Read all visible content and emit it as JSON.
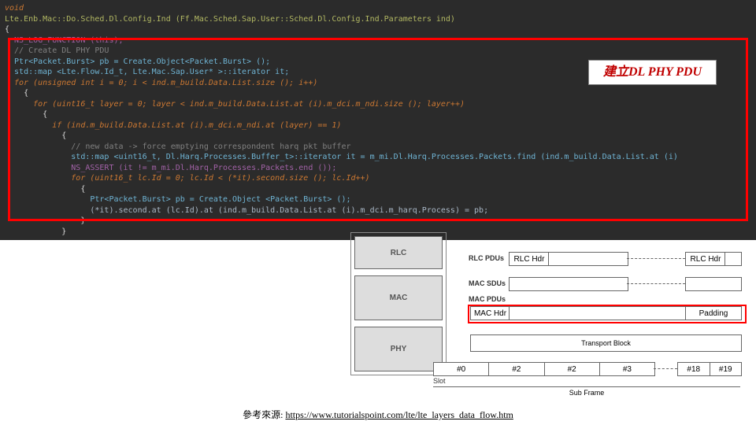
{
  "code": {
    "l1a": "void",
    "l1b": "Lte.Enb.Mac::Do.Sched.Dl.Config.Ind (Ff.Mac.Sched.Sap.User::Sched.Dl.Config.Ind.Parameters ind)",
    "l2": "{",
    "l3": "  NS_LOG_FUNCTION (this);",
    "l4": "  // Create DL PHY PDU",
    "l5": "  Ptr<Packet.Burst> pb = Create.Object<Packet.Burst> ();",
    "l6": "  std::map <Lte.Flow.Id_t, Lte.Mac.Sap.User* >::iterator it;",
    "l7": "",
    "l8": "  for (unsigned int i = 0; i < ind.m_build.Data.List.size (); i++)",
    "l9": "    {",
    "l10": "      for (uint16_t layer = 0; layer < ind.m_build.Data.List.at (i).m_dci.m_ndi.size (); layer++)",
    "l11": "        {",
    "l12": "          if (ind.m_build.Data.List.at (i).m_dci.m_ndi.at (layer) == 1)",
    "l13": "            {",
    "l14": "              // new data -> force emptying correspondent harq pkt buffer",
    "l15": "              std::map <uint16_t, Dl.Harq.Processes.Buffer_t>::iterator it = m_mi.Dl.Harq.Processes.Packets.find (ind.m_build.Data.List.at (i)",
    "l16": "              NS_ASSERT (it != m_mi.Dl.Harq.Processes.Packets.end ());",
    "l17": "              for (uint16_t lc.Id = 0; lc.Id < (*it).second.size (); lc.Id++)",
    "l18": "                {",
    "l19": "                  Ptr<Packet.Burst> pb = Create.Object <Packet.Burst> ();",
    "l20": "                  (*it).second.at (lc.Id).at (ind.m_build.Data.List.at (i).m_dci.m_harq.Process) = pb;",
    "l21": "                }",
    "l22": "            }"
  },
  "annotation": {
    "zh": "建立",
    "en": "DL PHY PDU"
  },
  "diagram": {
    "layers": {
      "rlc": "RLC",
      "mac": "MAC",
      "phy": "PHY"
    },
    "labels": {
      "rlcpdus": "RLC PDUs",
      "rlchdr": "RLC Hdr",
      "macsdus": "MAC SDUs",
      "macpdus": "MAC PDUs",
      "machdr": "MAC Hdr",
      "padding": "Padding",
      "tb": "Transport Block",
      "slot": "Slot",
      "subframe": "Sub Frame"
    },
    "slots": [
      "#0",
      "#2",
      "#2",
      "#3",
      "#18",
      "#19"
    ]
  },
  "footer": {
    "prefix": "參考來源: ",
    "url": "https://www.tutorialspoint.com/lte/lte_layers_data_flow.htm"
  }
}
